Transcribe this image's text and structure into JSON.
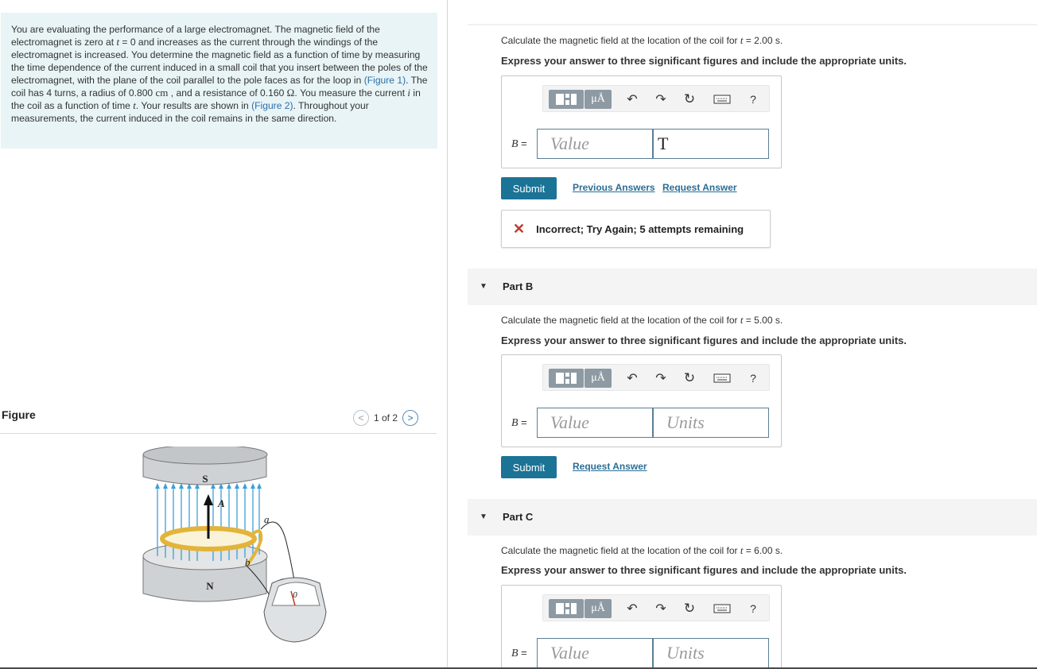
{
  "problem": {
    "seg1": "You are evaluating the performance of a large electromagnet. The magnetic field of the electromagnet is zero at ",
    "t_sym": "t",
    "seg2": " = 0 and increases as the current through the windings of the electromagnet is increased. You determine the magnetic field as a function of time by measuring the time dependence of the current induced in a small coil that you insert between the poles of the electromagnet, with the plane of the coil parallel to the pole faces as for the loop in ",
    "fig1_link": "(Figure 1)",
    "seg3": ". The coil has 4 turns, a radius of 0.800 ",
    "unit_cm": "cm",
    "seg4": " , and a resistance of 0.160 ",
    "unit_ohm": "Ω",
    "seg5": ". You measure the current ",
    "i_sym": "i",
    "seg6": " in the coil as a function of time ",
    "seg7": ". Your results are shown in ",
    "fig2_link": "(Figure 2)",
    "seg8": ". Throughout your measurements, the current induced in the coil remains in the same direction."
  },
  "figure": {
    "title": "Figure",
    "pager": "1 of 2",
    "labels": {
      "s": "S",
      "n": "N",
      "a_vec": "A",
      "a": "a",
      "b": "b",
      "zero": "0"
    }
  },
  "partA": {
    "q_prefix": "Calculate the magnetic field at the location of the coil for ",
    "q_t": "t",
    "q_suffix": " = 2.00 s.",
    "hint": "Express your answer to three significant figures and include the appropriate units.",
    "b_label": "B",
    "b_eq": " =",
    "value_placeholder": "Value",
    "unit_value": "T",
    "submit": "Submit",
    "prev_answers": "Previous Answers",
    "request_answer": "Request Answer",
    "feedback_icon": "✕",
    "feedback": "Incorrect; Try Again; 5 attempts remaining"
  },
  "partB": {
    "title": "Part B",
    "q_prefix": "Calculate the magnetic field at the location of the coil for ",
    "q_t": "t",
    "q_suffix": " = 5.00 s.",
    "hint": "Express your answer to three significant figures and include the appropriate units.",
    "b_label": "B",
    "b_eq": " =",
    "value_placeholder": "Value",
    "units_placeholder": "Units",
    "submit": "Submit",
    "request_answer": "Request Answer"
  },
  "partC": {
    "title": "Part C",
    "q_prefix": "Calculate the magnetic field at the location of the coil for ",
    "q_t": "t",
    "q_suffix": " = 6.00 s.",
    "hint": "Express your answer to three significant figures and include the appropriate units.",
    "b_label": "B",
    "b_eq": " =",
    "value_placeholder": "Value",
    "units_placeholder": "Units"
  },
  "toolbar": {
    "mu_label": "μÅ",
    "undo_icon": "↶",
    "redo_icon": "↷",
    "reset_icon": "↻",
    "help_label": "?"
  },
  "colors": {
    "accent": "#1b7396",
    "link": "#2a6e96",
    "problem_bg": "#e8f4f6",
    "error": "#c0392b"
  }
}
